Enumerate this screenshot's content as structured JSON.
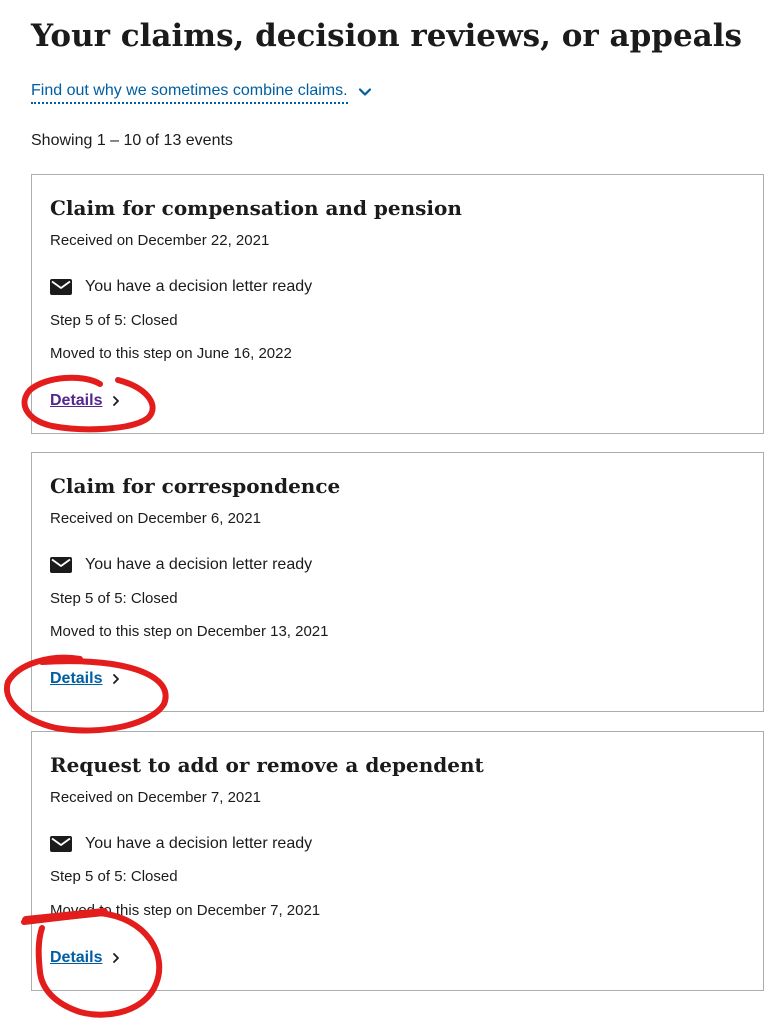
{
  "header": {
    "title": "Your claims, decision reviews, or appeals",
    "combine_link": "Find out why we sometimes combine claims."
  },
  "summary": {
    "showing": "Showing 1 – 10 of 13 events"
  },
  "claims": [
    {
      "title": "Claim for compensation and pension",
      "received": "Received on December 22, 2021",
      "letter": "You have a decision letter ready",
      "step": "Step 5 of 5: Closed",
      "moved": "Moved to this step on June 16, 2022",
      "details_label": "Details"
    },
    {
      "title": "Claim for correspondence",
      "received": "Received on December 6, 2021",
      "letter": "You have a decision letter ready",
      "step": "Step 5 of 5: Closed",
      "moved": "Moved to this step on December 13, 2021",
      "details_label": "Details"
    },
    {
      "title": "Request to add or remove a dependent",
      "received": "Received on December 7, 2021",
      "letter": "You have a decision letter ready",
      "step": "Step 5 of 5: Closed",
      "moved": "Moved to this step on December 7, 2021",
      "details_label": "Details"
    }
  ],
  "colors": {
    "link": "#005ea2",
    "visited_link": "#54278f",
    "card_border": "#a9aeb1",
    "annotation": "#e31c1c"
  }
}
